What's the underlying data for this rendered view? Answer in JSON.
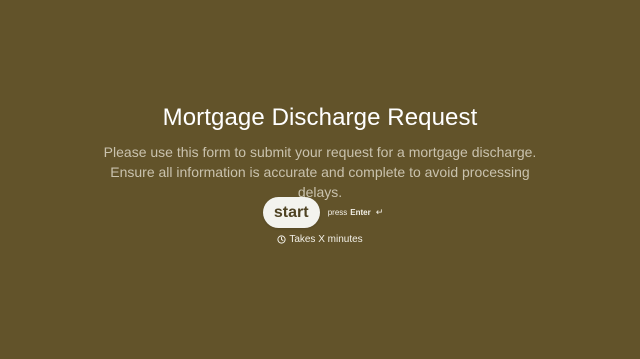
{
  "form": {
    "title": "Mortgage Discharge Request",
    "description": "Please use this form to submit your request for a mortgage discharge. Ensure all information is accurate and complete to avoid processing delays.",
    "start_label": "start",
    "press_label": "press",
    "enter_key": "Enter",
    "enter_icon": "↵",
    "time_estimate": "Takes X minutes"
  },
  "icons": {
    "clock": "clock-icon",
    "enter": "enter-key-icon"
  },
  "colors": {
    "background": "#62532a",
    "button_background": "#f3f3ee",
    "button_text": "#4f4323",
    "title": "#ffffff",
    "description": "#c9c2ad"
  }
}
